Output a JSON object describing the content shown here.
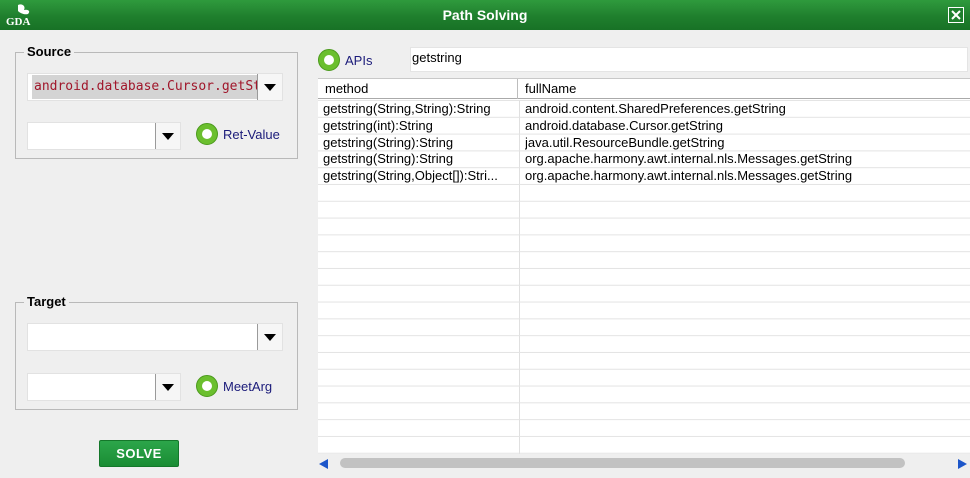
{
  "window": {
    "title": "Path Solving",
    "logo_text": "GDA",
    "close_icon": "close-icon"
  },
  "source": {
    "legend": "Source",
    "api_combo_value": "android.database.Cursor.getSt",
    "value_combo_value": "",
    "radio_label": "Ret-Value"
  },
  "target": {
    "legend": "Target",
    "api_combo_value": "",
    "value_combo_value": "",
    "radio_label": "MeetArg"
  },
  "apis": {
    "radio_label": "APIs",
    "search_value": "getstring"
  },
  "table": {
    "columns": [
      "method",
      "fullName"
    ],
    "rows": [
      {
        "method": "getstring(String,String):String",
        "fullName": "android.content.SharedPreferences.getString"
      },
      {
        "method": "getstring(int):String",
        "fullName": "android.database.Cursor.getString"
      },
      {
        "method": "getstring(String):String",
        "fullName": "java.util.ResourceBundle.getString"
      },
      {
        "method": "getstring(String):String",
        "fullName": "org.apache.harmony.awt.internal.nls.Messages.getString"
      },
      {
        "method": "getstring(String,Object[]):Stri...",
        "fullName": "org.apache.harmony.awt.internal.nls.Messages.getString"
      }
    ]
  },
  "actions": {
    "solve_label": "SOLVE"
  },
  "colors": {
    "titlebar": "#1f7f2d",
    "accent_green": "#6bbf2e",
    "radio_text": "#1b1b7a",
    "scroll_arrows": "#1d56c9"
  }
}
